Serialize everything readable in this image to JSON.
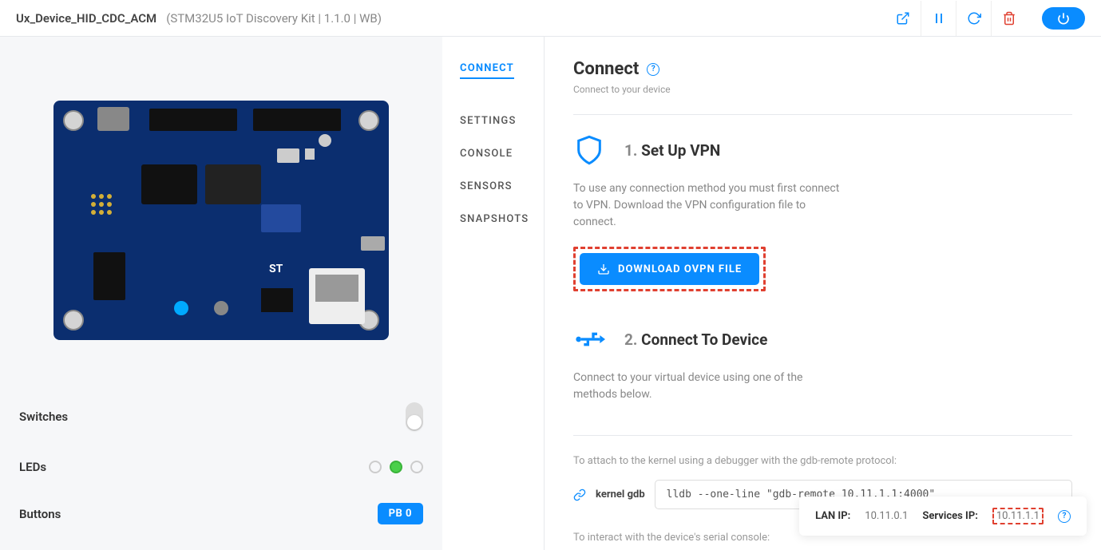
{
  "header": {
    "project_name": "Ux_Device_HID_CDC_ACM",
    "project_meta": "(STM32U5 IoT Discovery Kit | 1.1.0 | WB)"
  },
  "sidebar": {
    "items": [
      {
        "label": "CONNECT",
        "active": true
      },
      {
        "label": "SETTINGS",
        "active": false
      },
      {
        "label": "CONSOLE",
        "active": false
      },
      {
        "label": "SENSORS",
        "active": false
      },
      {
        "label": "SNAPSHOTS",
        "active": false
      }
    ]
  },
  "controls": {
    "switches_label": "Switches",
    "leds_label": "LEDs",
    "buttons_label": "Buttons",
    "pb_label": "PB 0"
  },
  "connect": {
    "title": "Connect",
    "subtitle": "Connect to your device",
    "step1": {
      "num": "1.",
      "title": "Set Up VPN",
      "desc": "To use any connection method you must first connect to VPN. Download the VPN configuration file to connect.",
      "button": "DOWNLOAD OVPN FILE"
    },
    "step2": {
      "num": "2.",
      "title": "Connect To Device",
      "desc": "Connect to your virtual device using one of the methods below."
    },
    "gdb_help": "To attach to the kernel using a debugger with the gdb-remote protocol:",
    "kernel_label": "kernel gdb",
    "kernel_cmd": "lldb --one-line \"gdb-remote 10.11.1.1:4000\"",
    "serial_help": "To interact with the device's serial console:"
  },
  "ip_panel": {
    "lan_label": "LAN IP:",
    "lan_value": "10.11.0.1",
    "services_label": "Services IP:",
    "services_value": "10.11.1.1"
  }
}
